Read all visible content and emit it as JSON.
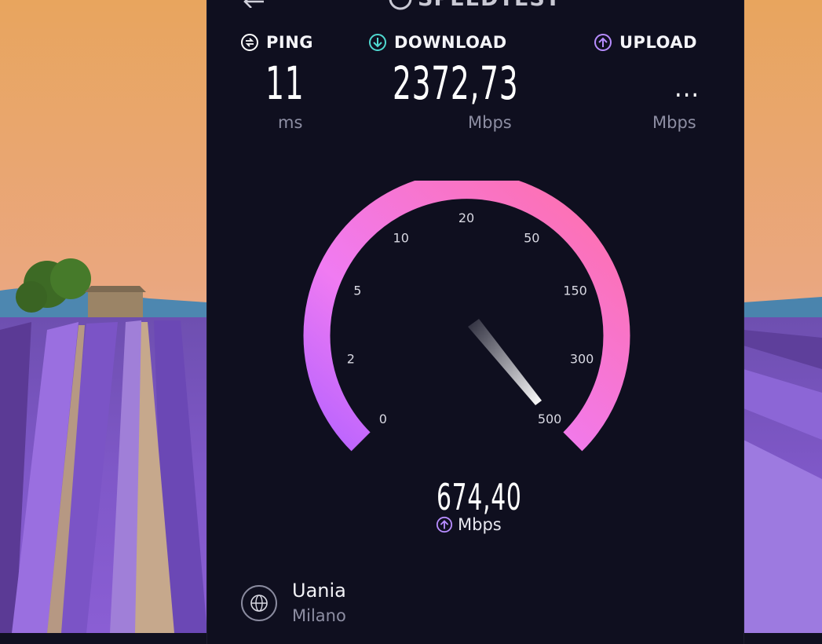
{
  "header": {
    "title": "SPEEDTEST"
  },
  "metrics": {
    "ping": {
      "label": "PING",
      "value": "11",
      "unit": "ms"
    },
    "download": {
      "label": "DOWNLOAD",
      "value": "2372,73",
      "unit": "Mbps"
    },
    "upload": {
      "label": "UPLOAD",
      "value": "...",
      "unit": "Mbps"
    }
  },
  "gauge": {
    "ticks": [
      "0",
      "2",
      "5",
      "10",
      "20",
      "50",
      "150",
      "300",
      "500"
    ],
    "current_value": "674,40",
    "current_unit": "Mbps",
    "needle_level": 1.0
  },
  "server": {
    "provider": "Uania",
    "location": "Milano"
  },
  "colors": {
    "panel_bg": "#0f0f1f",
    "arc_start": "#b763ff",
    "arc_end": "#ff6fa8",
    "download_icon": "#4fd8d0",
    "upload_icon": "#b78cff",
    "unit_text": "#8d8ea3"
  }
}
